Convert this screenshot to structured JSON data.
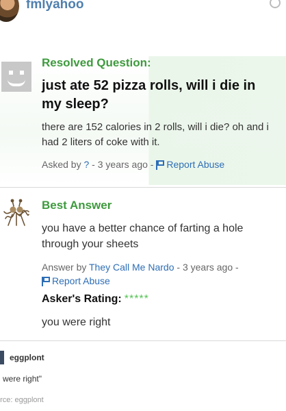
{
  "topbar": {
    "username": "fmlyahoo",
    "icon": "clock-icon"
  },
  "question": {
    "status_label": "Resolved Question:",
    "title": "just ate 52 pizza rolls, will i die in my sleep?",
    "body": "there are 152 calories in 2 rolls, will i die? oh and i had 2 liters of coke with it.",
    "asked_by_prefix": "Asked by",
    "asker": "?",
    "time": "3 years ago",
    "separator": " - ",
    "report_label": "Report Abuse",
    "avatar_icon": "default-smiley-avatar-icon"
  },
  "answer": {
    "heading": "Best Answer",
    "body": "you have a better chance of farting a hole through your sheets",
    "answer_by_prefix": "Answer by",
    "answerer": "They Call Me Nardo",
    "time": "3 years ago",
    "report_label": "Report Abuse",
    "rating_label": "Asker's Rating:",
    "rating_stars": "*****",
    "rating_value": 5,
    "rating_max": 5,
    "asker_comment": "you were right",
    "avatar_icon": "spaghetti-monster-avatar-icon"
  },
  "reblog": {
    "username": "eggplont",
    "quote": "u were right\"",
    "source": "urce: eggplont"
  },
  "colors": {
    "green_heading": "#3e9a3e",
    "link_blue": "#2d6eb6",
    "username_blue": "#4f7fae",
    "star_green": "#56c256"
  }
}
